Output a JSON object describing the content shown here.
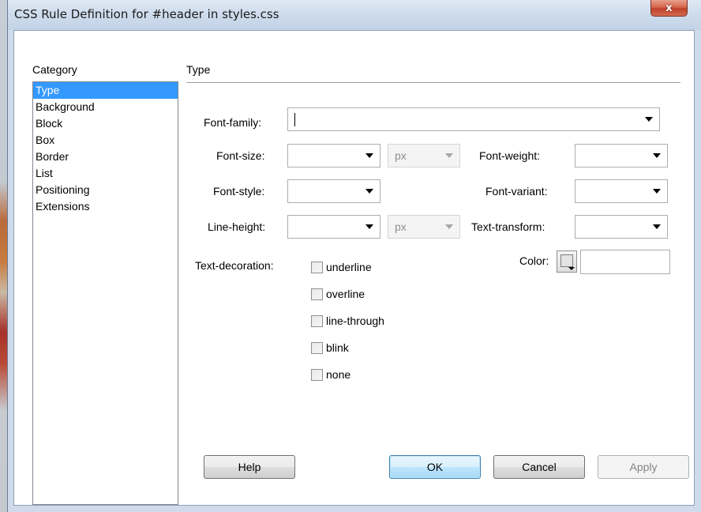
{
  "window": {
    "title": "CSS Rule Definition for #header in styles.css",
    "close_glyph": "x"
  },
  "category": {
    "label": "Category",
    "items": [
      "Type",
      "Background",
      "Block",
      "Box",
      "Border",
      "List",
      "Positioning",
      "Extensions"
    ],
    "selected": "Type"
  },
  "panel": {
    "title": "Type",
    "font_family": {
      "label": "Font-family:",
      "value": ""
    },
    "font_size": {
      "label": "Font-size:",
      "value": "",
      "unit": "px"
    },
    "font_style": {
      "label": "Font-style:",
      "value": ""
    },
    "line_height": {
      "label": "Line-height:",
      "value": "",
      "unit": "px"
    },
    "text_decoration": {
      "label": "Text-decoration:",
      "options": [
        "underline",
        "overline",
        "line-through",
        "blink",
        "none"
      ]
    },
    "font_weight": {
      "label": "Font-weight:",
      "value": ""
    },
    "font_variant": {
      "label": "Font-variant:",
      "value": ""
    },
    "text_transform": {
      "label": "Text-transform:",
      "value": ""
    },
    "color": {
      "label": "Color:",
      "value": ""
    }
  },
  "buttons": {
    "help": "Help",
    "ok": "OK",
    "cancel": "Cancel",
    "apply": "Apply"
  },
  "colors": {
    "selection": "#3399ff",
    "dialog_frame": "#cfdbea",
    "close_button": "#c0402a"
  }
}
